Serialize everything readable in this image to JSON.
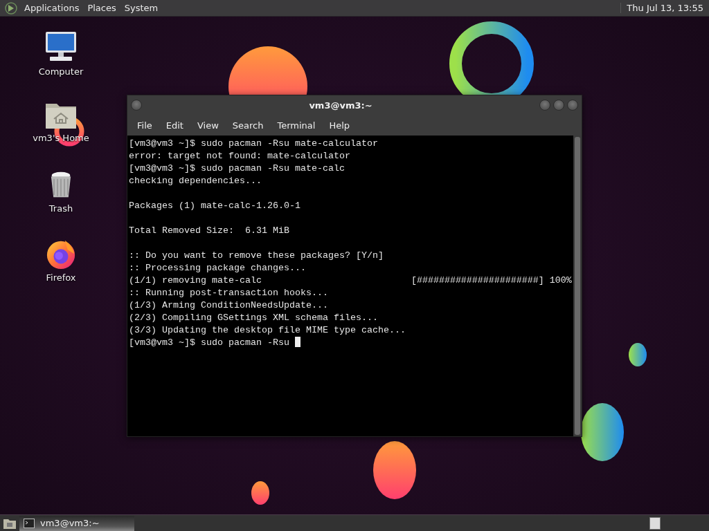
{
  "top_panel": {
    "menus": [
      "Applications",
      "Places",
      "System"
    ],
    "clock": "Thu Jul 13, 13:55"
  },
  "desktop_icons": [
    {
      "label": "Computer",
      "kind": "computer"
    },
    {
      "label": "vm3's Home",
      "kind": "home"
    },
    {
      "label": "Trash",
      "kind": "trash"
    },
    {
      "label": "Firefox",
      "kind": "browser"
    }
  ],
  "terminal": {
    "title": "vm3@vm3:~",
    "menus": [
      "File",
      "Edit",
      "View",
      "Search",
      "Terminal",
      "Help"
    ],
    "blocks": [
      [
        {
          "kind": "text",
          "text": "[vm3@vm3 ~]$ sudo pacman -Rsu mate-calculator"
        },
        {
          "kind": "text",
          "text": "error: target not found: mate-calculator"
        },
        {
          "kind": "text",
          "text": "[vm3@vm3 ~]$ sudo pacman -Rsu mate-calc"
        },
        {
          "kind": "text",
          "text": "checking dependencies..."
        }
      ],
      [
        {
          "kind": "text",
          "text": "Packages (1) mate-calc-1.26.0-1"
        }
      ],
      [
        {
          "kind": "text",
          "text": "Total Removed Size:  6.31 MiB"
        }
      ],
      [
        {
          "kind": "text",
          "text": ":: Do you want to remove these packages? [Y/n]"
        },
        {
          "kind": "text",
          "text": ":: Processing package changes..."
        },
        {
          "kind": "progress",
          "text": "(1/1) removing mate-calc",
          "progress": "[######################] 100%"
        },
        {
          "kind": "text",
          "text": ":: Running post-transaction hooks..."
        },
        {
          "kind": "text",
          "text": "(1/3) Arming ConditionNeedsUpdate..."
        },
        {
          "kind": "text",
          "text": "(2/3) Compiling GSettings XML schema files..."
        },
        {
          "kind": "text",
          "text": "(3/3) Updating the desktop file MIME type cache..."
        },
        {
          "kind": "prompt",
          "text": "[vm3@vm3 ~]$ sudo pacman -Rsu"
        }
      ]
    ],
    "cursor": true
  },
  "taskbar": {
    "tasks": [
      {
        "label": "vm3@vm3:~",
        "selected": true
      }
    ]
  }
}
